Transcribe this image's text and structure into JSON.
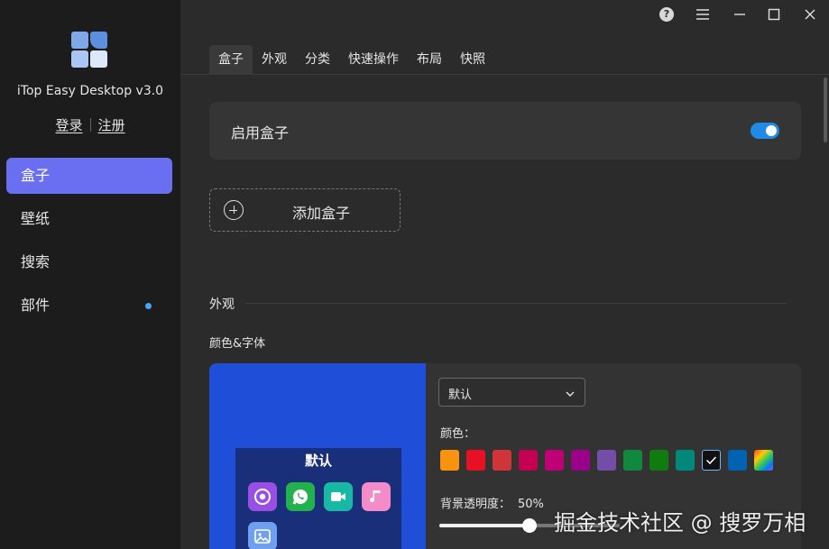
{
  "sidebar": {
    "app_title": "iTop Easy Desktop v3.0",
    "login": "登录",
    "register": "注册",
    "items": [
      {
        "label": "盒子",
        "active": true
      },
      {
        "label": "壁纸"
      },
      {
        "label": "搜索"
      },
      {
        "label": "部件",
        "has_dot": true
      }
    ]
  },
  "titlebar": {
    "icons": [
      "help-icon",
      "menu-icon",
      "minimize-icon",
      "maximize-icon",
      "close-icon"
    ],
    "help_glyph": "?"
  },
  "tabs": [
    {
      "label": "盒子",
      "active": true
    },
    {
      "label": "外观"
    },
    {
      "label": "分类"
    },
    {
      "label": "快速操作"
    },
    {
      "label": "布局"
    },
    {
      "label": "快照"
    }
  ],
  "enable_card": {
    "label": "启用盒子",
    "enabled": true
  },
  "add_box": {
    "label": "添加盒子"
  },
  "appearance_section": {
    "title": "外观",
    "color_font_label": "颜色&字体",
    "preview_title": "默认",
    "theme_dropdown": {
      "value": "默认"
    },
    "color_label": "颜色：",
    "swatches": [
      "#f7930e",
      "#e81123",
      "#d13438",
      "#c30052",
      "#bf0077",
      "#9a0089",
      "#744da9",
      "#10893e",
      "#107c10",
      "#00897b",
      "#111111",
      "#0063b1",
      "rainbow"
    ],
    "selected_swatch_index": 10,
    "opacity_label": "背景透明度：",
    "opacity_value": "50%",
    "opacity_fraction": 0.5
  },
  "watermark": "掘金技术社区 @ 搜罗万相",
  "colors": {
    "accent": "#6a6ef0",
    "toggle_on": "#1e8be6",
    "preview_bg": "#1f4fd8"
  }
}
